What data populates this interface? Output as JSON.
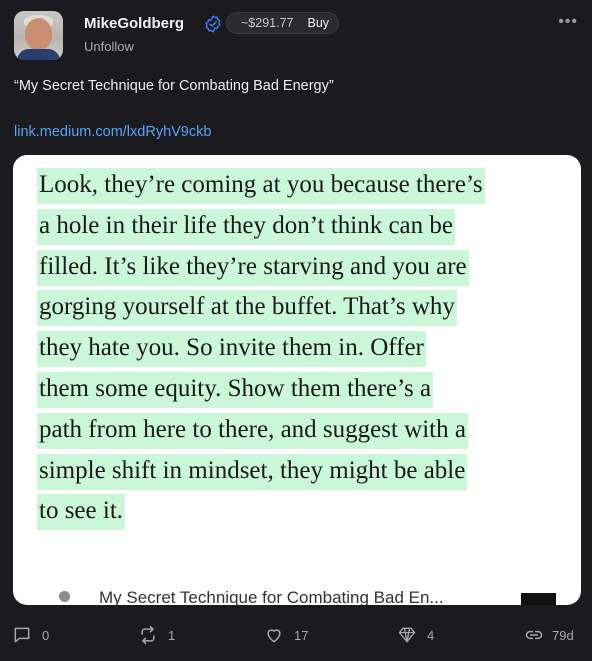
{
  "author": {
    "name": "MikeGoldberg",
    "follow_action": "Unfollow"
  },
  "price_pill": {
    "price": "~$291.77",
    "buy_label": "Buy"
  },
  "post": {
    "text": "“My Secret Technique for Combating Bad Energy”",
    "link": "link.medium.com/lxdRyhV9ckb"
  },
  "card": {
    "quote_lines": [
      "Look, they’re coming at you because there’s",
      "a hole in their life they don’t think can be",
      "filled. It’s like they’re starving and you are",
      "gorging yourself at the buffet. That’s why",
      "they hate you. So invite them in. Offer",
      "them some equity. Show them there’s a",
      "path from here to there, and suggest with a",
      "simple shift in mindset, they might be able",
      "to see it."
    ],
    "footer_title": "My Secret Technique for Combating Bad En..."
  },
  "actions": {
    "replies": "0",
    "reposts": "1",
    "likes": "17",
    "tips": "4",
    "age": "79d"
  },
  "colors": {
    "background": "#1b1b1f",
    "link": "#5aa2f5",
    "highlight": "#c9f7d7",
    "verified": "#3b82f6"
  }
}
